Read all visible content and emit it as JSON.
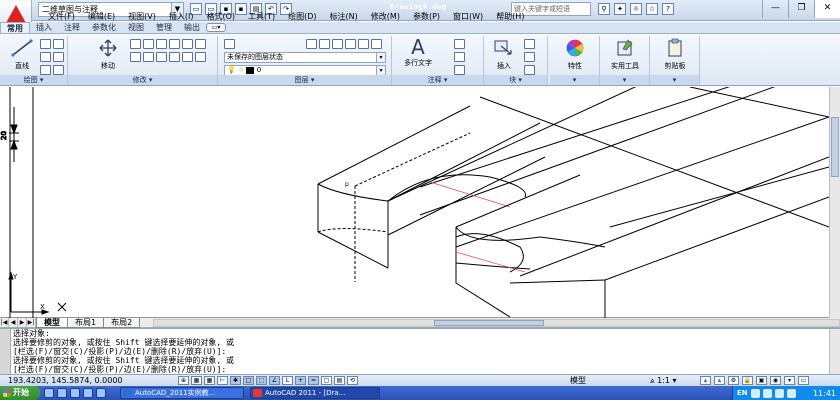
{
  "window": {
    "workspace": "二维草图与注释",
    "title": "Drawing6.dwg",
    "search_placeholder": "键入关键字或短语"
  },
  "menu": [
    "文件(F)",
    "编辑(E)",
    "视图(V)",
    "插入(I)",
    "格式(O)",
    "工具(T)",
    "绘图(D)",
    "标注(N)",
    "修改(M)",
    "参数(P)",
    "窗口(W)",
    "帮助(H)"
  ],
  "ribbon_tabs": [
    {
      "label": "常用",
      "active": true
    },
    {
      "label": "插入"
    },
    {
      "label": "注释"
    },
    {
      "label": "参数化"
    },
    {
      "label": "视图"
    },
    {
      "label": "管理"
    },
    {
      "label": "输出"
    }
  ],
  "ribbon": {
    "line_label": "直线",
    "move_label": "移动",
    "layer_state": "未保存的图层状态",
    "layer_current": "0",
    "mtext_label": "多行文字",
    "insert_label": "插入",
    "properties_label": "特性",
    "utilities_label": "实用工具",
    "clipboard_label": "剪贴板",
    "panels": {
      "draw": "绘图",
      "modify": "修改",
      "layers": "图层",
      "annotation": "注释",
      "block": "块"
    }
  },
  "layout_tabs": [
    {
      "label": "模型",
      "active": true
    },
    {
      "label": "布局1"
    },
    {
      "label": "布局2"
    }
  ],
  "command_lines": [
    "选择对象:",
    "选择要修剪的对象, 或按住 Shift 键选择要延伸的对象, 或",
    "[栏选(F)/窗交(C)/投影(P)/边(E)/删除(R)/放弃(U)]:",
    "选择要修剪的对象, 或按住 Shift 键选择要延伸的对象, 或",
    "[栏选(F)/窗交(C)/投影(P)/边(E)/删除(R)/放弃(U)]:"
  ],
  "status": {
    "coords": "193.4203, 145.5874, 0.0000",
    "space": "模型",
    "scale": "1:1"
  },
  "taskbar": {
    "start": "开始",
    "tasks": [
      "AutoCAD_2011实例教...",
      "AutoCAD 2011 - [Dra..."
    ],
    "lang": "EN",
    "clock": "11:41"
  }
}
